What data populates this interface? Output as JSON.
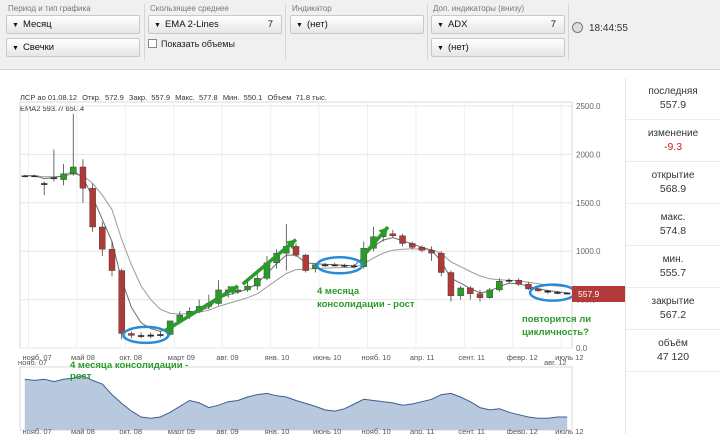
{
  "toolbar": {
    "period": {
      "label": "Период и тип графика",
      "period_value": "Месяц",
      "type_value": "Свечки"
    },
    "ma": {
      "label": "Скользящее среднее",
      "value": "EMA 2-Lines",
      "number": "7",
      "volume_checkbox": "Показать объемы"
    },
    "indicator": {
      "label": "Индикатор",
      "value": "(нет)"
    },
    "extra": {
      "label": "Доп. индикаторы (внизу)",
      "value1": "ADX",
      "number1": "7",
      "value2": "(нет)"
    },
    "time": "18:44:55"
  },
  "chart": {
    "info_line": {
      "ticker": "ЛСР ао 01.08.12",
      "open_label": "Откр.",
      "open": "572.9",
      "close_label": "Закр.",
      "close": "557.9",
      "high_label": "Макс.",
      "high": "577.8",
      "low_label": "Мин.",
      "low": "550.1",
      "volume_label": "Объем",
      "volume": "71.8 тыс."
    },
    "ema_label": "EMA2 593.7/ 650.4",
    "price_tag": "557.9",
    "annotations": {
      "a1": "4 месяца консолидации - рост",
      "a2": "4 месяца консолидации - рост",
      "a3": "повторится ли цикличность?"
    }
  },
  "chart_data": {
    "type": "candlestick",
    "ylim": [
      0,
      2500
    ],
    "y_ticks": [
      "0.0",
      "500.0",
      "1000.0",
      "1500.0",
      "2000.0",
      "2500.0"
    ],
    "x_ticks": [
      "нояб. 07",
      "май 08",
      "окт. 08",
      "март 09",
      "авг. 09",
      "янв. 10",
      "июнь 10",
      "нояб. 10",
      "апр. 11",
      "сент. 11",
      "февр. 12",
      "июль 12"
    ],
    "bottom_x_ticks": [
      "нояб. 07",
      "май 08",
      "окт. 08",
      "март 09",
      "авг. 09",
      "янв. 10",
      "июнь 10",
      "нояб. 10",
      "апр. 11",
      "сент. 11",
      "февр. 12",
      "июль 12"
    ],
    "bottom_top_labels": [
      "нояб. 07",
      "авг. 12"
    ],
    "candles": [
      {
        "o": 1780,
        "h": 1790,
        "l": 1770,
        "c": 1780
      },
      {
        "o": 1780,
        "h": 1790,
        "l": 1770,
        "c": 1780
      },
      {
        "o": 1700,
        "h": 1720,
        "l": 1580,
        "c": 1700
      },
      {
        "o": 1750,
        "h": 2050,
        "l": 1720,
        "c": 1760
      },
      {
        "o": 1740,
        "h": 1900,
        "l": 1680,
        "c": 1800
      },
      {
        "o": 1800,
        "h": 2420,
        "l": 1780,
        "c": 1870
      },
      {
        "o": 1870,
        "h": 1950,
        "l": 1500,
        "c": 1650
      },
      {
        "o": 1650,
        "h": 1700,
        "l": 1200,
        "c": 1250
      },
      {
        "o": 1250,
        "h": 1300,
        "l": 950,
        "c": 1020
      },
      {
        "o": 1020,
        "h": 1100,
        "l": 740,
        "c": 800
      },
      {
        "o": 800,
        "h": 820,
        "l": 90,
        "c": 150
      },
      {
        "o": 150,
        "h": 170,
        "l": 100,
        "c": 130
      },
      {
        "o": 130,
        "h": 160,
        "l": 100,
        "c": 120
      },
      {
        "o": 120,
        "h": 160,
        "l": 100,
        "c": 135
      },
      {
        "o": 135,
        "h": 170,
        "l": 110,
        "c": 140
      },
      {
        "o": 140,
        "h": 260,
        "l": 130,
        "c": 280
      },
      {
        "o": 280,
        "h": 380,
        "l": 260,
        "c": 340
      },
      {
        "o": 340,
        "h": 420,
        "l": 300,
        "c": 380
      },
      {
        "o": 380,
        "h": 500,
        "l": 360,
        "c": 430
      },
      {
        "o": 430,
        "h": 550,
        "l": 400,
        "c": 460
      },
      {
        "o": 460,
        "h": 700,
        "l": 440,
        "c": 600
      },
      {
        "o": 600,
        "h": 640,
        "l": 520,
        "c": 580
      },
      {
        "o": 580,
        "h": 640,
        "l": 560,
        "c": 600
      },
      {
        "o": 600,
        "h": 700,
        "l": 580,
        "c": 640
      },
      {
        "o": 640,
        "h": 800,
        "l": 600,
        "c": 720
      },
      {
        "o": 720,
        "h": 950,
        "l": 700,
        "c": 880
      },
      {
        "o": 880,
        "h": 1020,
        "l": 820,
        "c": 980
      },
      {
        "o": 980,
        "h": 1280,
        "l": 800,
        "c": 1050
      },
      {
        "o": 1050,
        "h": 1080,
        "l": 940,
        "c": 960
      },
      {
        "o": 960,
        "h": 970,
        "l": 780,
        "c": 800
      },
      {
        "o": 820,
        "h": 880,
        "l": 780,
        "c": 860
      },
      {
        "o": 860,
        "h": 880,
        "l": 840,
        "c": 860
      },
      {
        "o": 860,
        "h": 880,
        "l": 840,
        "c": 855
      },
      {
        "o": 855,
        "h": 870,
        "l": 830,
        "c": 850
      },
      {
        "o": 850,
        "h": 870,
        "l": 820,
        "c": 840
      },
      {
        "o": 840,
        "h": 1100,
        "l": 820,
        "c": 1030
      },
      {
        "o": 1030,
        "h": 1250,
        "l": 1000,
        "c": 1150
      },
      {
        "o": 1150,
        "h": 1220,
        "l": 1100,
        "c": 1180
      },
      {
        "o": 1180,
        "h": 1220,
        "l": 1140,
        "c": 1160
      },
      {
        "o": 1160,
        "h": 1180,
        "l": 1050,
        "c": 1080
      },
      {
        "o": 1080,
        "h": 1100,
        "l": 1020,
        "c": 1040
      },
      {
        "o": 1040,
        "h": 1060,
        "l": 990,
        "c": 1010
      },
      {
        "o": 1010,
        "h": 1050,
        "l": 900,
        "c": 980
      },
      {
        "o": 980,
        "h": 1000,
        "l": 740,
        "c": 780
      },
      {
        "o": 780,
        "h": 800,
        "l": 480,
        "c": 540
      },
      {
        "o": 540,
        "h": 640,
        "l": 500,
        "c": 620
      },
      {
        "o": 620,
        "h": 640,
        "l": 500,
        "c": 560
      },
      {
        "o": 560,
        "h": 600,
        "l": 480,
        "c": 520
      },
      {
        "o": 520,
        "h": 620,
        "l": 510,
        "c": 600
      },
      {
        "o": 600,
        "h": 720,
        "l": 580,
        "c": 690
      },
      {
        "o": 690,
        "h": 720,
        "l": 670,
        "c": 700
      },
      {
        "o": 700,
        "h": 720,
        "l": 640,
        "c": 660
      },
      {
        "o": 660,
        "h": 680,
        "l": 600,
        "c": 610
      },
      {
        "o": 610,
        "h": 620,
        "l": 580,
        "c": 590
      },
      {
        "o": 590,
        "h": 600,
        "l": 560,
        "c": 575
      },
      {
        "o": 575,
        "h": 590,
        "l": 555,
        "c": 568
      },
      {
        "o": 569,
        "h": 575,
        "l": 556,
        "c": 558
      }
    ],
    "ema_fast": [
      1780,
      1780,
      1750,
      1760,
      1780,
      1830,
      1760,
      1560,
      1330,
      1100,
      700,
      420,
      260,
      200,
      170,
      220,
      280,
      330,
      380,
      420,
      510,
      550,
      575,
      610,
      665,
      770,
      870,
      960,
      960,
      880,
      870,
      865,
      860,
      855,
      848,
      940,
      1050,
      1115,
      1140,
      1110,
      1075,
      1040,
      1010,
      895,
      720,
      670,
      615,
      570,
      585,
      637,
      668,
      664,
      637,
      613,
      594,
      581,
      569
    ],
    "ema_slow": [
      1780,
      1780,
      1770,
      1770,
      1775,
      1800,
      1780,
      1700,
      1580,
      1430,
      1120,
      860,
      640,
      500,
      400,
      360,
      350,
      355,
      370,
      390,
      430,
      460,
      490,
      520,
      560,
      630,
      700,
      770,
      810,
      815,
      820,
      825,
      830,
      832,
      833,
      870,
      930,
      980,
      1010,
      1020,
      1025,
      1022,
      1018,
      975,
      890,
      840,
      790,
      745,
      715,
      705,
      700,
      695,
      680,
      665,
      650,
      640,
      630
    ],
    "volume_area": [
      0.86,
      0.84,
      0.86,
      0.82,
      0.86,
      0.88,
      0.92,
      0.84,
      0.78,
      0.6,
      0.45,
      0.32,
      0.22,
      0.2,
      0.22,
      0.3,
      0.4,
      0.5,
      0.46,
      0.38,
      0.42,
      0.48,
      0.5,
      0.56,
      0.6,
      0.62,
      0.58,
      0.56,
      0.5,
      0.45,
      0.4,
      0.34,
      0.32,
      0.36,
      0.44,
      0.52,
      0.5,
      0.48,
      0.46,
      0.42,
      0.44,
      0.48,
      0.52,
      0.6,
      0.62,
      0.56,
      0.48,
      0.38,
      0.34,
      0.36,
      0.3,
      0.26,
      0.22,
      0.2,
      0.2,
      0.22,
      0.22
    ],
    "last_price": 557.9
  },
  "stats": [
    {
      "label": "последняя",
      "value": "557.9",
      "neg": false
    },
    {
      "label": "изменение",
      "value": "-9.3",
      "neg": true
    },
    {
      "label": "открытие",
      "value": "568.9",
      "neg": false
    },
    {
      "label": "макс.",
      "value": "574.8",
      "neg": false
    },
    {
      "label": "мин.",
      "value": "555.7",
      "neg": false
    },
    {
      "label": "закрытие",
      "value": "567.2",
      "neg": false
    },
    {
      "label": "объём",
      "value": "47 120",
      "neg": false
    }
  ],
  "colors": {
    "up": "#2a9a2a",
    "down": "#b03a3a",
    "accent": "#2a9a2a",
    "circle": "#2a8ad6",
    "price_tag": "#b33a3a",
    "volume_fill": "#b8c9de",
    "volume_line": "#3a5f95"
  }
}
